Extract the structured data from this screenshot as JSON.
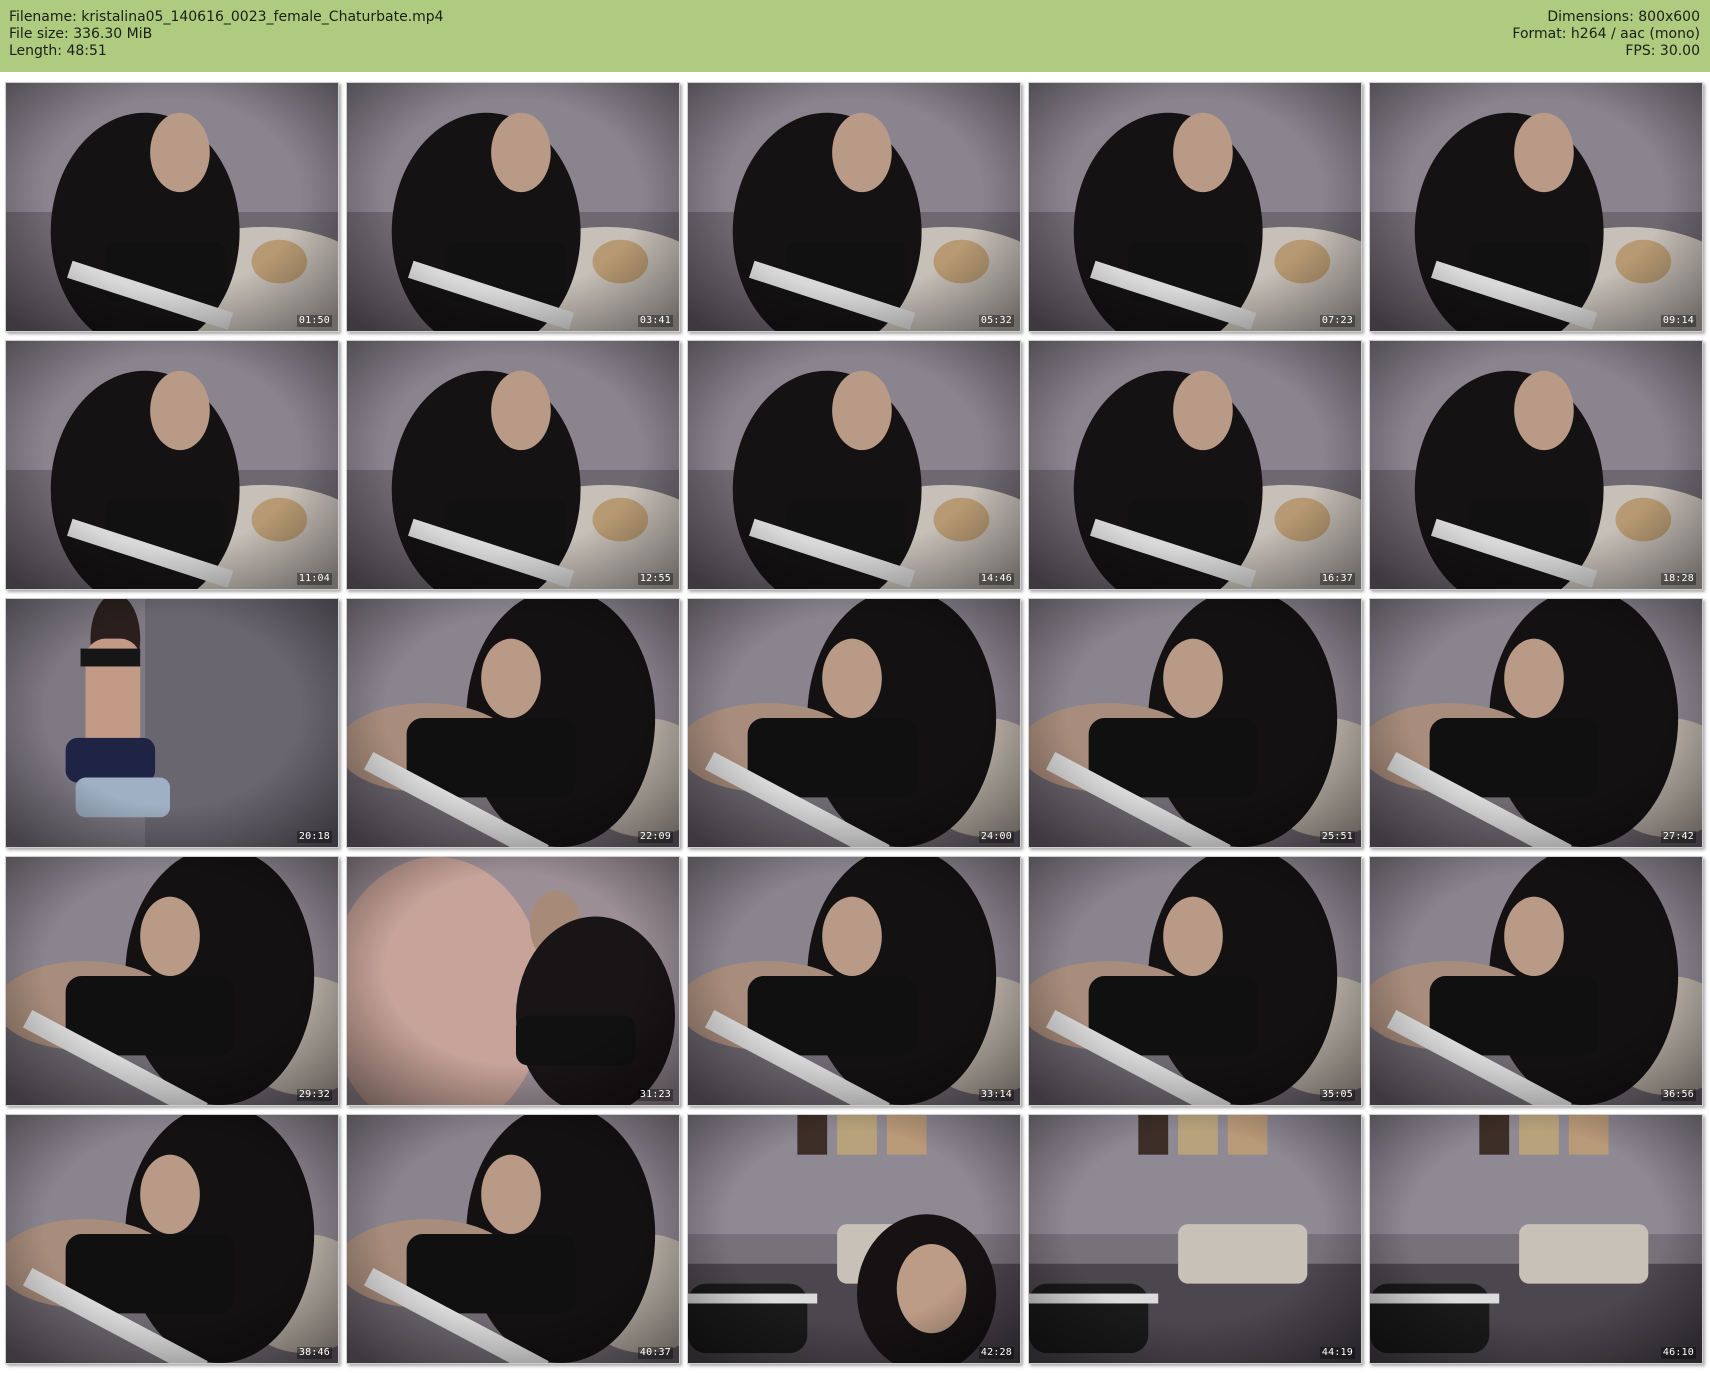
{
  "header": {
    "filename_line": "Filename: kristalina05_140616_0023_female_Chaturbate.mp4",
    "filesize_line": "File size: 336.30 MiB",
    "length_line": "Length: 48:51",
    "dimensions_line": "Dimensions: 800x600",
    "format_line": "Format: h264 / aac (mono)",
    "fps_line": "FPS: 30.00"
  },
  "colors": {
    "header_background": "#aecb80",
    "page_background": "#ffffff",
    "timestamp_text": "#ffffff"
  },
  "thumbnails": [
    {
      "time": "01:50",
      "scene": "portrait-bed"
    },
    {
      "time": "03:41",
      "scene": "portrait-bed"
    },
    {
      "time": "05:32",
      "scene": "portrait-bed"
    },
    {
      "time": "07:23",
      "scene": "portrait-bed"
    },
    {
      "time": "09:14",
      "scene": "portrait-bed"
    },
    {
      "time": "11:04",
      "scene": "portrait-bed"
    },
    {
      "time": "12:55",
      "scene": "portrait-bed"
    },
    {
      "time": "14:46",
      "scene": "portrait-bed"
    },
    {
      "time": "16:37",
      "scene": "portrait-bed"
    },
    {
      "time": "18:28",
      "scene": "portrait-bed"
    },
    {
      "time": "20:18",
      "scene": "standing-wall"
    },
    {
      "time": "22:09",
      "scene": "reclining"
    },
    {
      "time": "24:00",
      "scene": "reclining"
    },
    {
      "time": "25:51",
      "scene": "reclining"
    },
    {
      "time": "27:42",
      "scene": "reclining"
    },
    {
      "time": "29:32",
      "scene": "reclining"
    },
    {
      "time": "31:23",
      "scene": "blurred-close"
    },
    {
      "time": "33:14",
      "scene": "reclining"
    },
    {
      "time": "35:05",
      "scene": "reclining"
    },
    {
      "time": "36:56",
      "scene": "reclining"
    },
    {
      "time": "38:46",
      "scene": "reclining"
    },
    {
      "time": "40:37",
      "scene": "reclining"
    },
    {
      "time": "42:28",
      "scene": "room-wide-face"
    },
    {
      "time": "44:19",
      "scene": "room-wide"
    },
    {
      "time": "46:10",
      "scene": "room-wide"
    }
  ]
}
